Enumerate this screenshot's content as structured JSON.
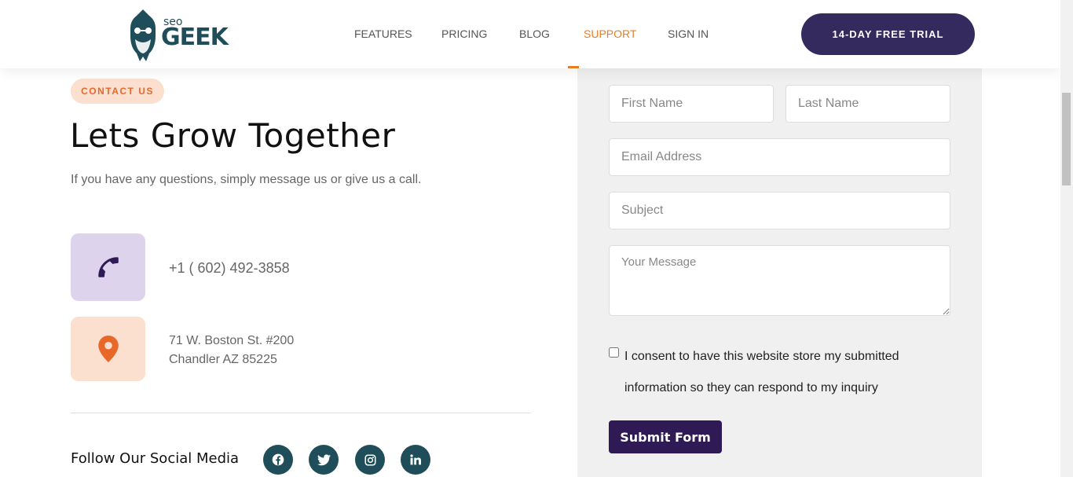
{
  "header": {
    "logo_small": "seo",
    "logo_big": "GEEK",
    "nav": [
      {
        "label": "FEATURES",
        "active": false
      },
      {
        "label": "PRICING",
        "active": false
      },
      {
        "label": "BLOG",
        "active": false
      },
      {
        "label": "SUPPORT",
        "active": true
      },
      {
        "label": "SIGN IN",
        "active": false
      }
    ],
    "cta": "14-DAY FREE TRIAL"
  },
  "contact": {
    "badge": "CONTACT US",
    "title": "Lets Grow Together",
    "subtitle": "If you have any questions, simply message us or give us a call.",
    "phone": "+1 ( 602) 492-3858",
    "address_line1": "71 W. Boston St. #200",
    "address_line2": "Chandler AZ 85225",
    "follow_label": "Follow Our Social Media",
    "socials": [
      "facebook-icon",
      "twitter-icon",
      "instagram-icon",
      "linkedin-icon"
    ]
  },
  "form": {
    "first_name_placeholder": "First Name",
    "last_name_placeholder": "Last Name",
    "email_placeholder": "Email Address",
    "subject_placeholder": "Subject",
    "message_placeholder": "Your Message",
    "consent": "I consent to have this website store my submitted information so they can respond to my inquiry",
    "submit": "Submit Form"
  },
  "colors": {
    "brand_dark": "#352a5e",
    "accent_orange": "#e67e22",
    "teal": "#1f4e5a"
  }
}
